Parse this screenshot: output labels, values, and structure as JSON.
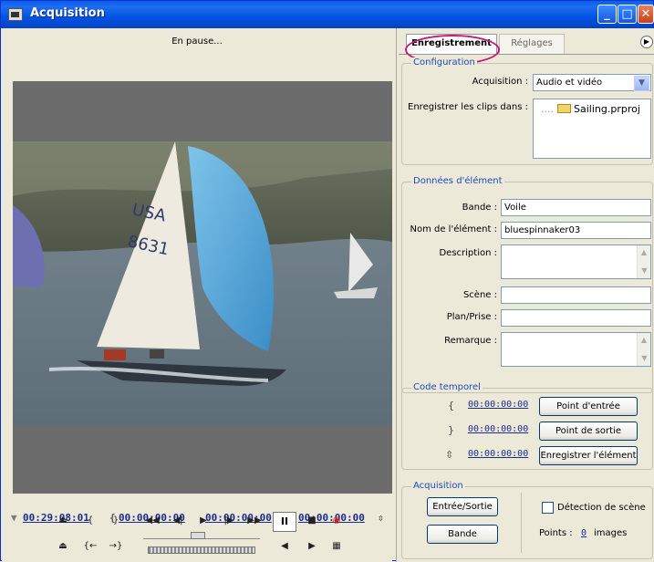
{
  "window": {
    "title": "Acquisition"
  },
  "monitor": {
    "status": "En pause...",
    "timecodes": {
      "current": "00:29:08:01",
      "in_point": "00:00:00:00",
      "out_point": "00:00:00:00",
      "duration": "00:00:00:00"
    },
    "transport": {
      "pause_label": "II"
    }
  },
  "tabs": [
    {
      "label": "Enregistrement",
      "active": true
    },
    {
      "label": "Réglages",
      "active": false
    }
  ],
  "configuration": {
    "group_label": "Configuration",
    "acquisition_label": "Acquisition :",
    "acquisition_value": "Audio et vidéo",
    "save_clips_label": "Enregistrer les clips dans :",
    "project_file": "Sailing.prproj"
  },
  "clip_data": {
    "group_label": "Données d'élément",
    "tape_label": "Bande :",
    "tape_value": "Voile",
    "clip_name_label": "Nom de l'élément :",
    "clip_name_value": "bluespinnaker03",
    "description_label": "Description :",
    "scene_label": "Scène :",
    "shot_label": "Plan/Prise :",
    "comment_label": "Remarque :"
  },
  "timecode": {
    "group_label": "Code temporel",
    "in_value": "00:00:00:00",
    "out_value": "00:00:00:00",
    "duration_value": "00:00:00:00",
    "set_in_label": "Point d'entrée",
    "set_out_label": "Point de sortie",
    "log_clip_label": "Enregistrer l'élément"
  },
  "capture": {
    "group_label": "Acquisition",
    "in_out_label": "Entrée/Sortie",
    "tape_label": "Bande",
    "scene_detect_label": "Détection de scène",
    "handles_label": "Points :",
    "handles_value": "0",
    "handles_unit": "images"
  },
  "colors": {
    "accent": "#1c4bbd",
    "highlight": "#c61a7e",
    "titlebar": "#0153e3"
  }
}
